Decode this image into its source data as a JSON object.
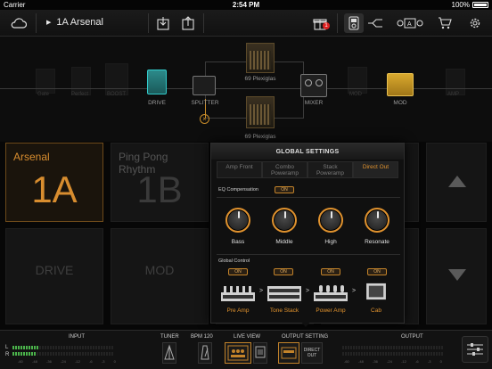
{
  "status": {
    "carrier": "Carrier",
    "time": "2:54 PM",
    "battery": "100%"
  },
  "toolbar": {
    "preset_name": "1A Arsenal",
    "gift_badge": "1"
  },
  "chain": {
    "labels": {
      "drive": "DRIVE",
      "splitter": "SPLITTER",
      "amp1": "69 Plexiglas",
      "amp2": "69 Plexiglas",
      "mixer": "MIXER",
      "mod": "MOD"
    },
    "ghost_labels": [
      "Gate",
      "Perfect",
      "BOOST",
      "PRE",
      "COMP",
      "MOD",
      "AMP"
    ]
  },
  "grid": {
    "cells": [
      {
        "title": "Arsenal",
        "big": "1A"
      },
      {
        "title": "Ping Pong Rhythm",
        "big": "1B"
      },
      {
        "title": "",
        "big": ""
      },
      {
        "title": "",
        "big": ""
      }
    ],
    "row2": [
      "DRIVE",
      "MOD",
      "",
      ""
    ]
  },
  "popup": {
    "title": "GLOBAL SETTINGS",
    "tabs": [
      "Amp Front",
      "Combo Poweramp",
      "Stack Poweramp",
      "Direct Out"
    ],
    "eq_label": "EQ Compensation",
    "on": "ON",
    "knobs": [
      "Bass",
      "Middle",
      "High",
      "Resonate"
    ],
    "global_label": "Global Control",
    "controls": [
      "Pre Amp",
      "Tone Stack",
      "Power Amp",
      "Cab"
    ]
  },
  "bottom": {
    "input": "INPUT",
    "tuner": "TUNER",
    "bpm": "BPM 120",
    "live_view": "LIVE VIEW",
    "output_setting": "OUTPUT SETTING",
    "direct_out": "DIRECT OUT",
    "output": "OUTPUT",
    "channel_l": "L",
    "channel_r": "R",
    "ticks": [
      "-60",
      "-48",
      "-36",
      "-24",
      "-12",
      "-6",
      "-3",
      "0"
    ]
  },
  "colors": {
    "accent": "#e0922e",
    "meter_green": "#4bb34b"
  }
}
